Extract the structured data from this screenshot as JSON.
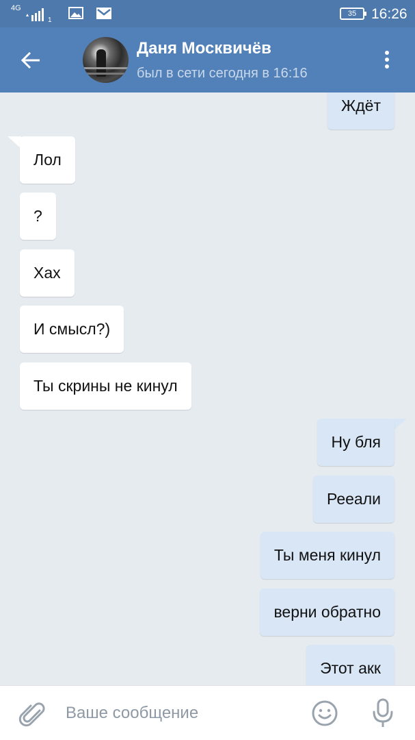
{
  "status_bar": {
    "network": "4G",
    "sim": "1",
    "battery": "35",
    "time": "16:26",
    "icons": [
      "signal-icon",
      "gallery-icon",
      "mail-icon",
      "battery-icon"
    ]
  },
  "header": {
    "contact_name": "Даня Москвичёв",
    "contact_status": "был в сети сегодня в 16:16",
    "icons": [
      "back-arrow-icon",
      "avatar",
      "more-vertical-icon"
    ]
  },
  "messages": [
    {
      "direction": "out",
      "text": "Ждёт"
    },
    {
      "direction": "in",
      "text": "Лол"
    },
    {
      "direction": "in",
      "text": "?"
    },
    {
      "direction": "in",
      "text": "Хах"
    },
    {
      "direction": "in",
      "text": "И смысл?)"
    },
    {
      "direction": "in",
      "text": "Ты скрины не кинул"
    },
    {
      "direction": "out",
      "text": "Ну бля"
    },
    {
      "direction": "out",
      "text": "Рееали"
    },
    {
      "direction": "out",
      "text": "Ты меня кинул"
    },
    {
      "direction": "out",
      "text": "верни обратно"
    },
    {
      "direction": "out",
      "text": "Этот акк"
    }
  ],
  "composer": {
    "placeholder": "Ваше сообщение",
    "value": "",
    "icons": [
      "paperclip-icon",
      "smiley-icon",
      "microphone-icon"
    ]
  },
  "colors": {
    "header_bg": "#5181b8",
    "status_bar_bg": "#4e79ad",
    "chat_bg": "#e6ebf0",
    "incoming_bubble": "#ffffff",
    "outgoing_bubble": "#d8e6f5",
    "icon_gray": "#99a3ad"
  }
}
